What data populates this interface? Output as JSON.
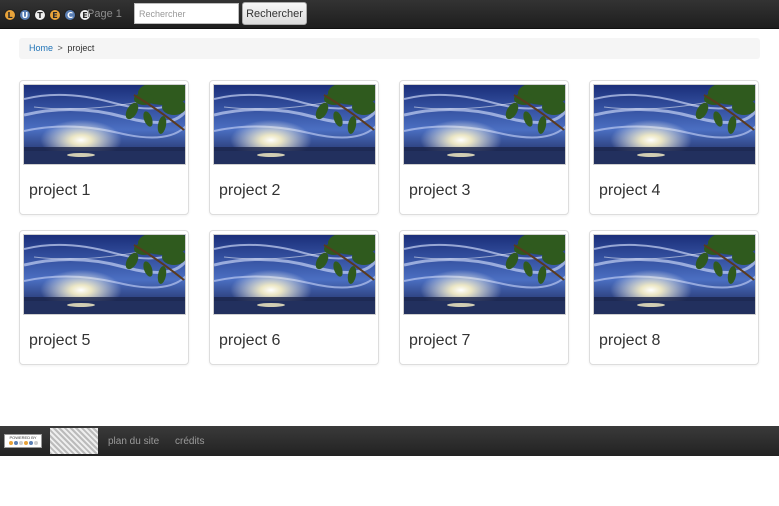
{
  "navbar": {
    "logo_letters": [
      "L",
      "U",
      "T",
      "E",
      "C",
      "E"
    ],
    "logo_colors": [
      "#e8a33a",
      "#5a7fb5",
      "#f0f0f0",
      "#e8a33a",
      "#5a7fb5",
      "#f0f0f0"
    ],
    "page_label": "Page 1",
    "search_placeholder": "Rechercher",
    "search_button": "Rechercher"
  },
  "breadcrumb": {
    "home": "Home",
    "separator": ">",
    "current": "project"
  },
  "projects": [
    {
      "title": "project 1"
    },
    {
      "title": "project 2"
    },
    {
      "title": "project 3"
    },
    {
      "title": "project 4"
    },
    {
      "title": "project 5"
    },
    {
      "title": "project 6"
    },
    {
      "title": "project 7"
    },
    {
      "title": "project 8"
    }
  ],
  "footer": {
    "powered_by": "POWERED BY",
    "sitemap": "plan du site",
    "credits": "crédits"
  },
  "colors": {
    "link": "#1f73b7",
    "navbar": "#2a2a2a"
  }
}
